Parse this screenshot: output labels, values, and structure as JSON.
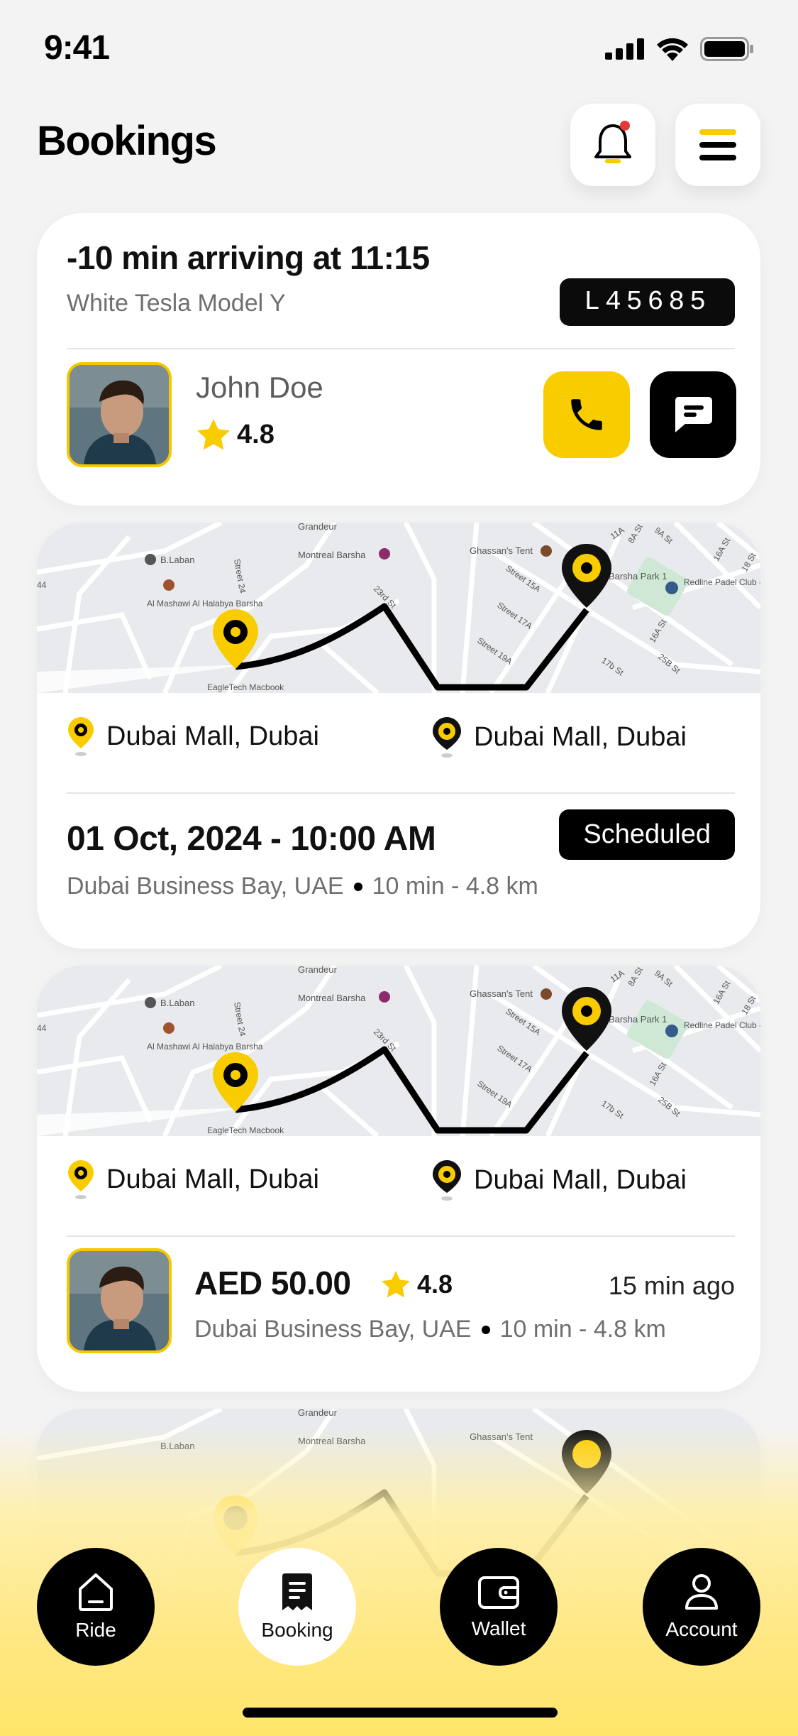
{
  "status_bar": {
    "time": "9:41"
  },
  "header": {
    "title": "Bookings"
  },
  "driver_card": {
    "eta": "-10 min arriving at 11:15",
    "car": "White Tesla Model Y",
    "plate": "L45685",
    "driver_name": "John Doe",
    "rating": "4.8"
  },
  "bookings": [
    {
      "from": "Dubai Mall, Dubai",
      "to": "Dubai Mall, Dubai",
      "datetime": "01 Oct, 2024 - 10:00 AM",
      "status": "Scheduled",
      "area": "Dubai Business Bay, UAE",
      "trip": "10 min - 4.8 km"
    },
    {
      "from": "Dubai Mall, Dubai",
      "to": "Dubai Mall, Dubai",
      "price": "AED 50.00",
      "rating": "4.8",
      "time_ago": "15 min ago",
      "area": "Dubai Business Bay, UAE",
      "trip": "10 min - 4.8 km"
    }
  ],
  "map_labels": {
    "grandeur": "Grandeur",
    "blaban": "B.Laban",
    "mashawi": "Al Mashawi Al Halabya Barsha",
    "montreal": "Montreal Barsha",
    "ghassan": "Ghassan's Tent",
    "barsha_park": "Barsha Park 1",
    "redline": "Redline Padel Club - Al Barsha",
    "eagletech": "EagleTech Macbook",
    "st_23rd": "23rd St",
    "st_24": "Street 24",
    "st_15a": "Street 15A",
    "st_17a": "Street 17A",
    "st_19a": "Street 19A",
    "st_17b": "17b St",
    "st_25b": "25B St",
    "st_16a": "16A St",
    "st_11a": "11A",
    "st_8a": "8A St",
    "st_9a": "9A St",
    "st_18": "18 St",
    "st_44": "44"
  },
  "nav": {
    "ride": "Ride",
    "booking": "Booking",
    "wallet": "Wallet",
    "account": "Account"
  },
  "colors": {
    "accent": "#F9CC00",
    "dark": "#000000",
    "map_bg": "#E8EAED"
  }
}
